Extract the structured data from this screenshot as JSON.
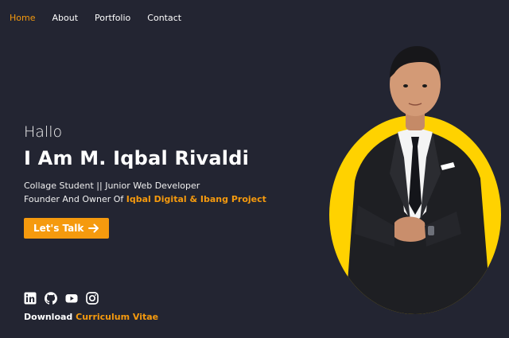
{
  "nav": {
    "items": [
      {
        "label": "Home",
        "active": true
      },
      {
        "label": "About",
        "active": false
      },
      {
        "label": "Portfolio",
        "active": false
      },
      {
        "label": "Contact",
        "active": false
      }
    ]
  },
  "hero": {
    "greeting": "Hallo",
    "name": "I Am M. Iqbal Rivaldi",
    "line1": "Collage Student || Junior Web Developer",
    "line2_prefix": "Founder And Owner Of ",
    "line2_highlight": "Iqbal Digital & Ibang Project",
    "cta_label": "Let's Talk"
  },
  "socials": [
    "linkedin-icon",
    "github-icon",
    "youtube-icon",
    "instagram-icon"
  ],
  "download": {
    "prefix": "Download ",
    "link": "Curriculum Vitae"
  },
  "colors": {
    "background": "#232532",
    "accent": "#f59a0e",
    "circle": "#ffd200"
  }
}
